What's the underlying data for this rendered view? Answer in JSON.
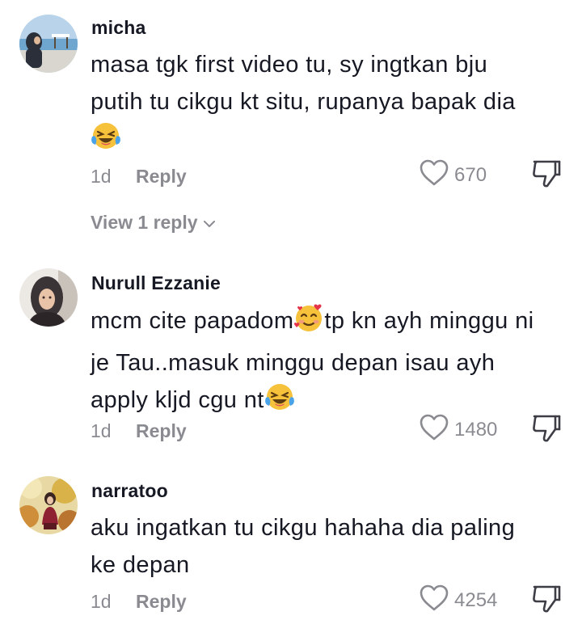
{
  "comments": [
    {
      "username": "micha",
      "lines": [
        "masa tgk first video tu, sy ingtkan bju",
        "putih tu cikgu kt situ, rupanya bapak dia"
      ],
      "date": "1d",
      "reply_label": "Reply",
      "likes": "670",
      "view_replies": "View 1 reply",
      "emoji": "laughing-tears"
    },
    {
      "username": "Nurull Ezzanie",
      "line1a": "mcm cite papadom",
      "line1b": "tp kn ayh minggu ni",
      "line2": "je Tau..masuk minggu depan isau ayh",
      "line3": "apply kljd cgu nt",
      "date": "1d",
      "reply_label": "Reply",
      "likes": "1480",
      "emojis": [
        "smiling-face-with-hearts",
        "laughing-tears"
      ]
    },
    {
      "username": "narratoo",
      "lines": [
        "aku ingatkan tu cikgu hahaha dia paling",
        "ke depan"
      ],
      "date": "1d",
      "reply_label": "Reply",
      "likes": "4254"
    }
  ],
  "colors": {
    "text": "#161823",
    "muted": "#8a8b91",
    "background": "#ffffff"
  },
  "icons": [
    "heart-outline-icon",
    "thumbs-down-icon",
    "chevron-down-icon"
  ]
}
